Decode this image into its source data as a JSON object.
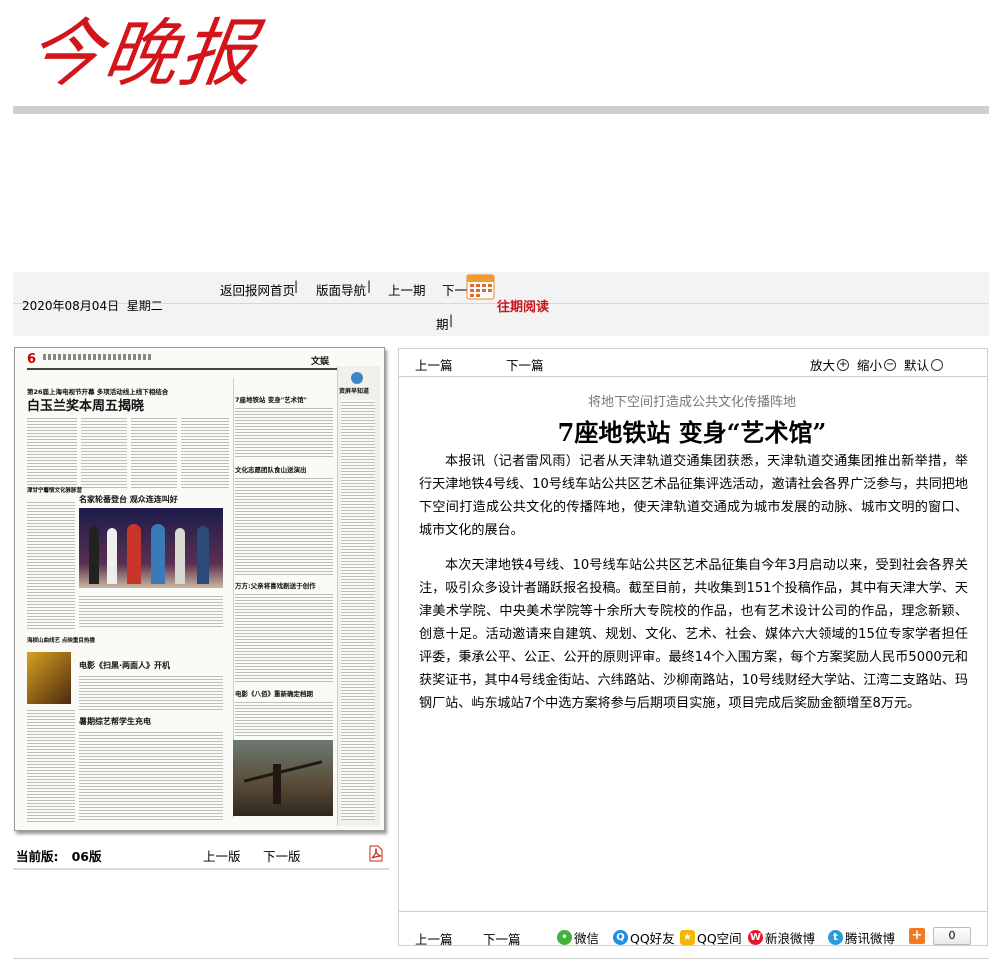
{
  "masthead": {
    "logo_text": "今晚报"
  },
  "nav": {
    "date": "2020年08月04日",
    "weekday": "星期二",
    "home": "返回报网首页",
    "layout_nav": "版面导航",
    "prev_issue": "上一期",
    "next_issue_a": "下一",
    "next_issue_b": "期",
    "archive": "往期阅读",
    "accent_color": "#c8161d"
  },
  "paper": {
    "page_no": "6",
    "section": "文娱",
    "sidebar_title": "资屏早知道",
    "headline_top_kicker": "第26届上海电视节开幕  多项活动线上线下相结合",
    "headline_main": "白玉兰奖本周五揭晓",
    "h_right_top": "7座地铁站 变身\"艺术馆\"",
    "h_right_2": "文化志愿团队食山送演出",
    "h_mid": "名家轮番登台 观众连连叫好",
    "h_right_3": "万方:父亲将喜戏剧送于创作",
    "h_left_side": "津甘宁馨情文化脉脉营",
    "h_left_side2": "海棂山曲线艺 点映重目热播",
    "h_mid2": "电影《扫黑·两面人》开机",
    "h_mid3": "暑期综艺帮学生充电",
    "h_right_4": "电影《八佰》重新确定档期"
  },
  "left_footer": {
    "current_label": "当前版:",
    "current_value": "06版",
    "prev": "上一版",
    "next": "下一版",
    "pdf_icon": "pdf-icon"
  },
  "article": {
    "toolbar": {
      "prev": "上一篇",
      "next": "下一篇",
      "zoom_in": "放大",
      "zoom_out": "缩小",
      "default": "默认"
    },
    "subtitle": "将地下空间打造成公共文化传播阵地",
    "title": "7座地铁站  变身“艺术馆”",
    "paragraphs": [
      "本报讯（记者雷风雨）记者从天津轨道交通集团获悉，天津轨道交通集团推出新举措，举行天津地铁4号线、10号线车站公共区艺术品征集评选活动，邀请社会各界广泛参与，共同把地下空间打造成公共文化的传播阵地，使天津轨道交通成为城市发展的动脉、城市文明的窗口、城市文化的展台。",
      "本次天津地铁4号线、10号线车站公共区艺术品征集自今年3月启动以来，受到社会各界关注，吸引众多设计者踊跃报名投稿。截至目前，共收集到151个投稿作品，其中有天津大学、天津美术学院、中央美术学院等十余所大专院校的作品，也有艺术设计公司的作品，理念新颖、创意十足。活动邀请来自建筑、规划、文化、艺术、社会、媒体六大领域的15位专家学者担任评委，秉承公平、公正、公开的原则评审。最终14个入围方案，每个方案奖励人民币5000元和获奖证书，其中4号线金街站、六纬路站、沙柳南路站，10号线财经大学站、江湾二支路站、玛钢厂站、屿东城站7个中选方案将参与后期项目实施，项目完成后奖励金额增至8万元。"
    ],
    "footer": {
      "prev": "上一篇",
      "next": "下一篇",
      "share_wechat": "微信",
      "share_qq": "QQ好友",
      "share_qzone": "QQ空间",
      "share_sina": "新浪微博",
      "share_tencent": "腾讯微博",
      "share_count": "0"
    }
  }
}
